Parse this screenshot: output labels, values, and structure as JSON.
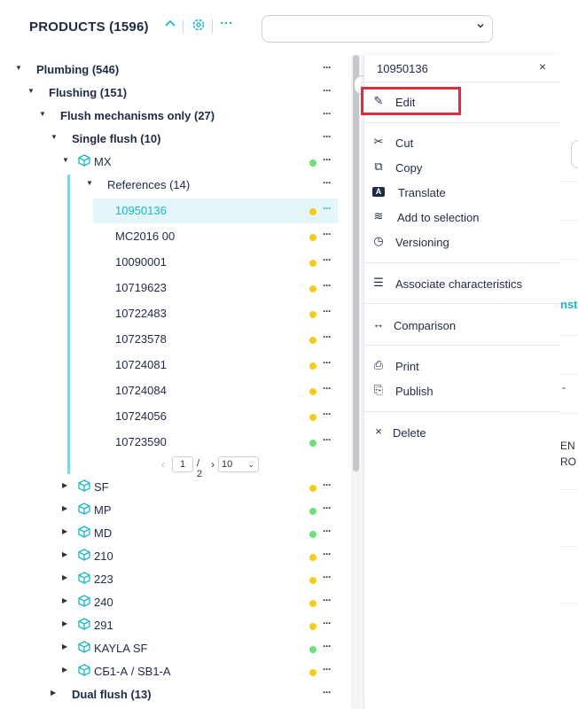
{
  "header": {
    "title": "PRODUCTS (1596)",
    "collapse_icon": "chevron-up-icon",
    "settings_icon": "gear-icon",
    "more_icon": "ellipsis-icon",
    "more_glyph": "···",
    "select_value": ""
  },
  "tree": {
    "plumbing": "Plumbing (546)",
    "flushing": "Flushing (151)",
    "flush_mech": "Flush mechanisms only (27)",
    "single_flush": "Single flush (10)",
    "mx": "MX",
    "references": "References (14)",
    "refs": [
      {
        "label": "10950136",
        "status": "yellow"
      },
      {
        "label": "MC2016 00",
        "status": "yellow"
      },
      {
        "label": "10090001",
        "status": "yellow"
      },
      {
        "label": "10719623",
        "status": "yellow"
      },
      {
        "label": "10722483",
        "status": "yellow"
      },
      {
        "label": "10723578",
        "status": "yellow"
      },
      {
        "label": "10724081",
        "status": "yellow"
      },
      {
        "label": "10724084",
        "status": "yellow"
      },
      {
        "label": "10724056",
        "status": "yellow"
      },
      {
        "label": "10723590",
        "status": "green"
      }
    ],
    "pager": {
      "page": "1",
      "total": "/ 2",
      "per_page": "10"
    },
    "models": [
      {
        "label": "SF",
        "status": "yellow"
      },
      {
        "label": "MP",
        "status": "green"
      },
      {
        "label": "MD",
        "status": "green"
      },
      {
        "label": "210",
        "status": "yellow"
      },
      {
        "label": "223",
        "status": "yellow"
      },
      {
        "label": "240",
        "status": "yellow"
      },
      {
        "label": "291",
        "status": "yellow"
      },
      {
        "label": "KAYLA SF",
        "status": "green"
      },
      {
        "label": "СБ1-А / SB1-A",
        "status": "yellow"
      }
    ],
    "dual_flush": "Dual flush (13)",
    "dots": "···"
  },
  "menu": {
    "title": "10950136",
    "close": "×",
    "items": [
      {
        "label": "Edit",
        "icon": "pencil-icon",
        "glyph": "✎"
      },
      {
        "label": "Cut",
        "icon": "scissors-icon",
        "glyph": "✂"
      },
      {
        "label": "Copy",
        "icon": "copy-icon",
        "glyph": "⧉"
      },
      {
        "label": "Translate",
        "icon": "translate-icon",
        "glyph": "A"
      },
      {
        "label": "Add to selection",
        "icon": "layers-icon",
        "glyph": "≋"
      },
      {
        "label": "Versioning",
        "icon": "history-icon",
        "glyph": "◷"
      },
      {
        "label": "Associate characteristics",
        "icon": "checklist-icon",
        "glyph": "☰"
      },
      {
        "label": "Comparison",
        "icon": "compare-icon",
        "glyph": "↔"
      },
      {
        "label": "Print",
        "icon": "printer-icon",
        "glyph": "⎙"
      },
      {
        "label": "Publish",
        "icon": "pdf-icon",
        "glyph": "⎘"
      },
      {
        "label": "Delete",
        "icon": "close-icon",
        "glyph": "×"
      }
    ]
  },
  "right_partial": {
    "t1": "nst",
    "t2": "-",
    "t3": "EN",
    "t4": "RO"
  },
  "colors": {
    "accent": "#19b8c7",
    "yellow": "#f2cc1d",
    "green": "#6ee07b",
    "highlight": "#e02d3c"
  }
}
